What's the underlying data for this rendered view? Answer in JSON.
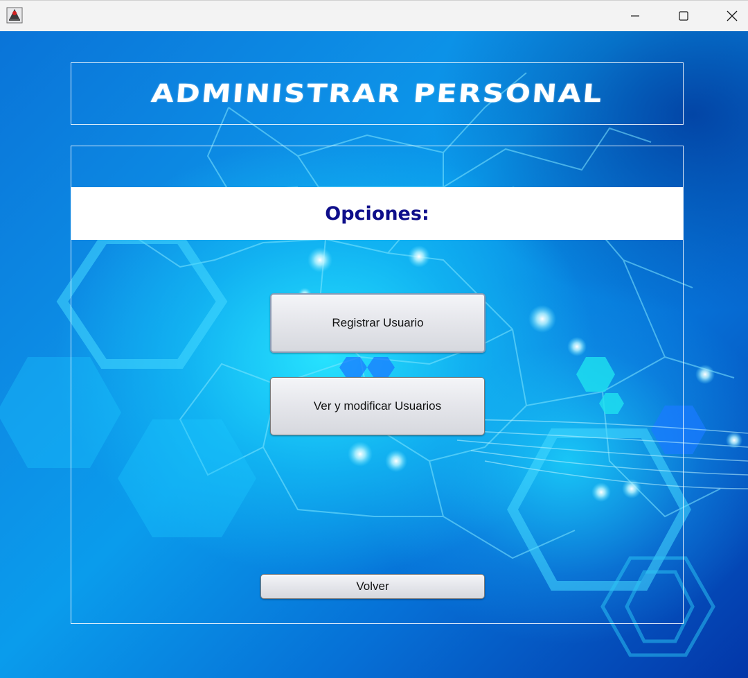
{
  "window": {
    "icon": "java-app-icon",
    "controls": {
      "minimize": "minimize-icon",
      "maximize": "maximize-icon",
      "close": "close-icon"
    }
  },
  "header": {
    "title": "ADMINISTRAR PERSONAL"
  },
  "panel": {
    "section_label": "Opciones:"
  },
  "buttons": {
    "register": "Registrar Usuario",
    "view_modify": "Ver y modificar Usuarios",
    "back": "Volver"
  },
  "colors": {
    "accent_blue": "#0e0e8a",
    "background_blue": "#0a74d8",
    "cyan_glow": "#28e6ff"
  }
}
